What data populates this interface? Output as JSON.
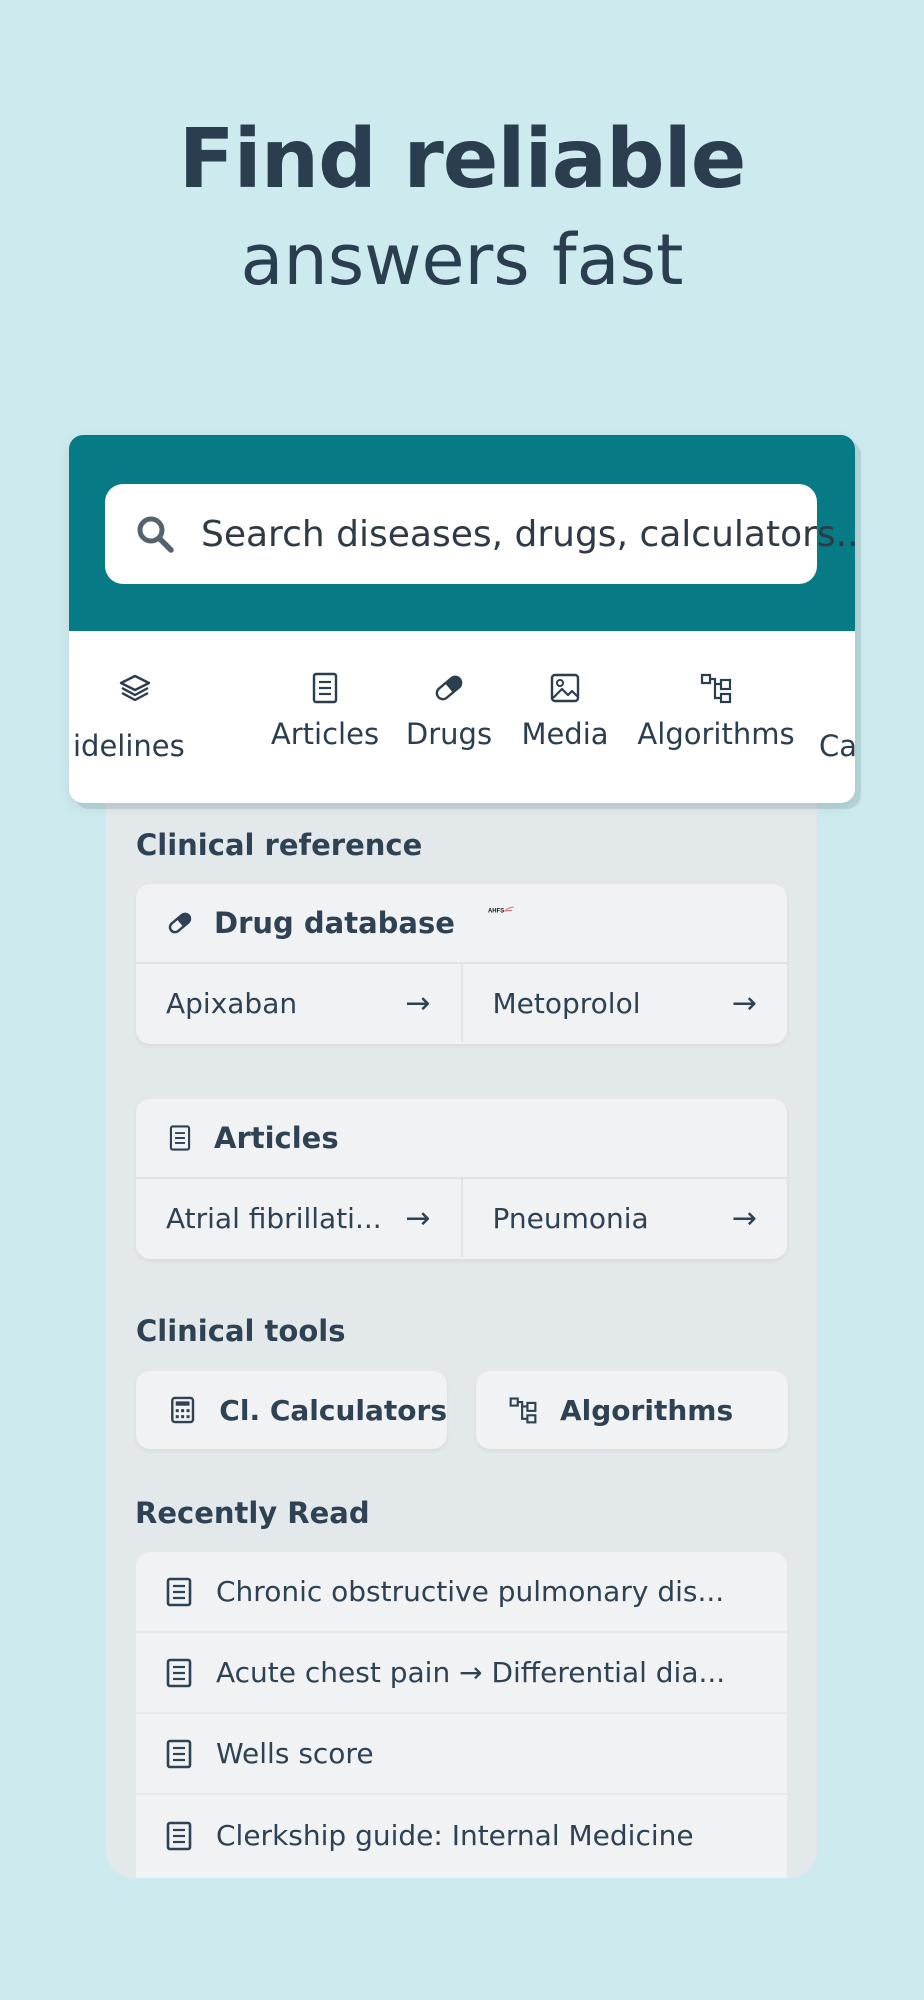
{
  "headline": {
    "line1": "Find reliable",
    "line2": "answers fast"
  },
  "search": {
    "placeholder": "Search diseases, drugs, calculators..."
  },
  "categories": [
    {
      "label": "idelines",
      "icon": "layers-icon"
    },
    {
      "label": "Articles",
      "icon": "document-icon"
    },
    {
      "label": "Drugs",
      "icon": "pill-icon"
    },
    {
      "label": "Media",
      "icon": "image-icon"
    },
    {
      "label": "Algorithms",
      "icon": "flowchart-icon"
    },
    {
      "label": "Calculat",
      "icon": "calculator-icon"
    }
  ],
  "clinical_reference": {
    "title": "Clinical reference",
    "drug_database": {
      "title": "Drug database",
      "logo_text": "AHFS",
      "items": [
        "Apixaban",
        "Metoprolol"
      ]
    },
    "articles": {
      "title": "Articles",
      "items": [
        "Atrial fibrillati...",
        "Pneumonia"
      ]
    }
  },
  "clinical_tools": {
    "title": "Clinical tools",
    "items": [
      "Cl. Calculators",
      "Algorithms"
    ]
  },
  "recently_read": {
    "title": "Recently Read",
    "items": [
      "Chronic obstructive pulmonary dis...",
      "Acute chest pain → Differential dia...",
      "Wells score",
      "Clerkship guide: Internal Medicine"
    ]
  },
  "arrow_glyph": "→",
  "colors": {
    "background": "#cdeaee",
    "header_teal": "#077b85",
    "text": "#2e4254"
  }
}
